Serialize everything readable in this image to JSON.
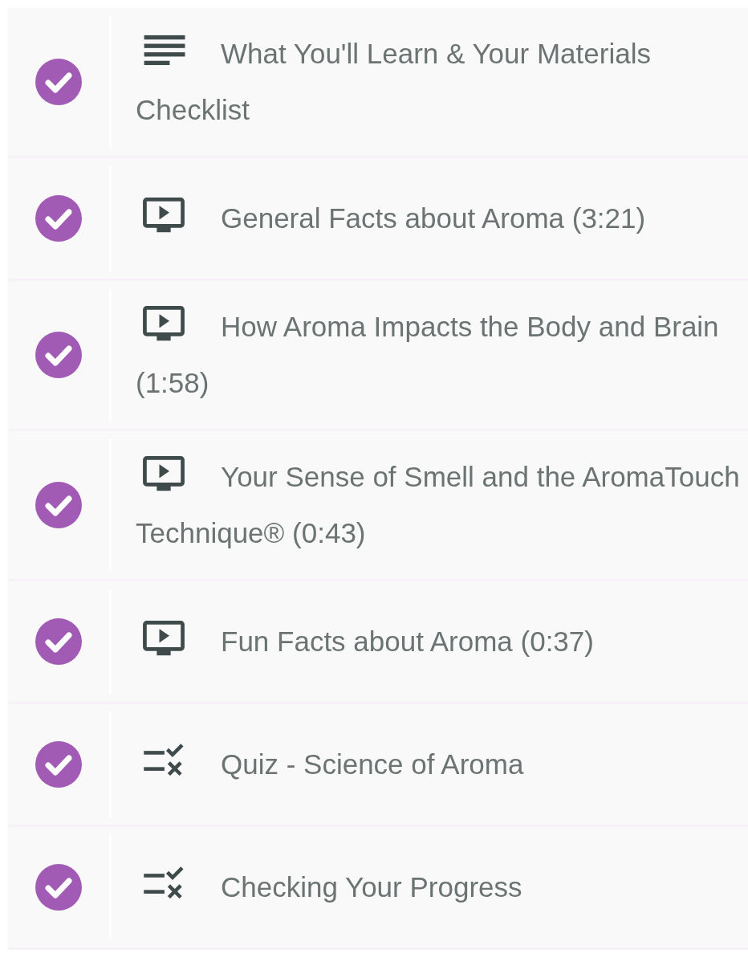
{
  "lessons": [
    {
      "kind": "text",
      "title": "What You'll Learn & Your Materials Checklist",
      "completed": true
    },
    {
      "kind": "video",
      "title": "General Facts about Aroma (3:21)",
      "completed": true
    },
    {
      "kind": "video",
      "title": "How Aroma Impacts the Body and Brain (1:58)",
      "completed": true
    },
    {
      "kind": "video",
      "title": "Your Sense of Smell and the AromaTouch Technique® (0:43)",
      "completed": true
    },
    {
      "kind": "video",
      "title": "Fun Facts about Aroma (0:37)",
      "completed": true
    },
    {
      "kind": "quiz",
      "title": "Quiz - Science of Aroma",
      "completed": true
    },
    {
      "kind": "quiz",
      "title": "Checking Your Progress",
      "completed": true
    }
  ]
}
